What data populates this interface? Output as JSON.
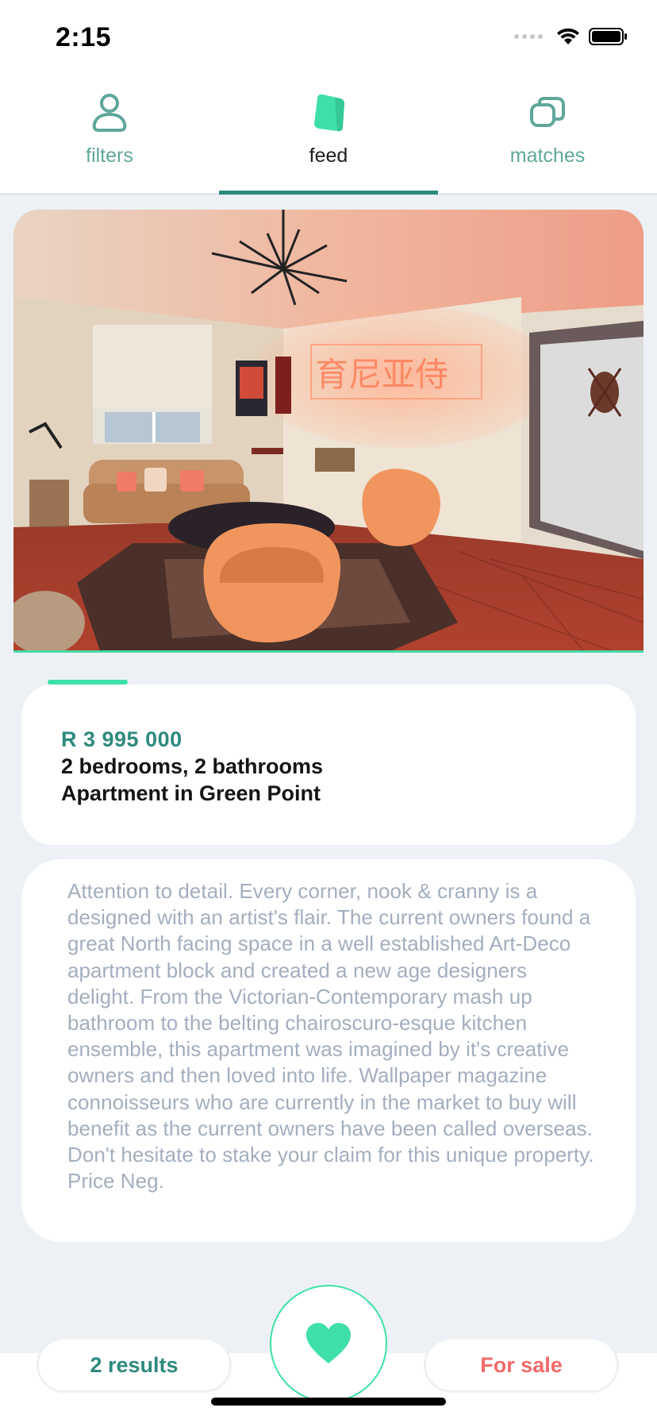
{
  "status_bar": {
    "time": "2:15"
  },
  "tabs": [
    {
      "label": "filters",
      "icon": "person-icon",
      "active": false
    },
    {
      "label": "feed",
      "icon": "cards-icon",
      "active": true
    },
    {
      "label": "matches",
      "icon": "stacked-squares-icon",
      "active": false
    }
  ],
  "listing": {
    "price": "R 3 995 000",
    "specs": "2 bedrooms, 2 bathrooms",
    "location": "Apartment in Green Point",
    "description": "Attention to detail. Every corner, nook & cranny is a designed with an artist's flair. The current owners found a great North facing space in a well established Art-Deco apartment block and created a new age designers delight. From the Victorian-Contemporary mash up bathroom to the belting chairoscuro-esque kitchen ensemble, this apartment was imagined by it's creative owners and then loved into life. Wallpaper magazine connoisseurs who are currently in the market to buy will benefit as the current owners have been called overseas. Don't hesitate to stake your claim for this unique property. Price Neg."
  },
  "bottom": {
    "results_label": "2 results",
    "sale_label": "For sale",
    "like_icon": "heart-icon"
  },
  "colors": {
    "accent": "#3fe0a7",
    "teal": "#2e8a7d",
    "sale": "#f26a6a",
    "muted_text": "#a3aebf"
  }
}
